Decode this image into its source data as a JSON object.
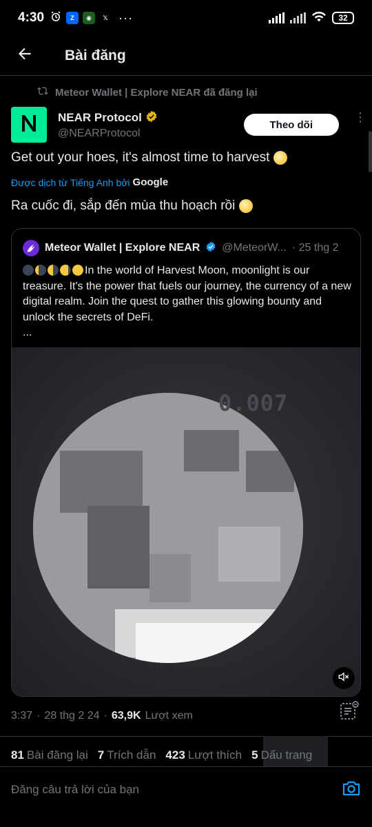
{
  "status_bar": {
    "time": "4:30",
    "battery": "32",
    "app_icons": [
      "zalo-icon",
      "app-icon",
      "x-icon"
    ],
    "dots": "···"
  },
  "header": {
    "title": "Bài đăng"
  },
  "repost": {
    "text": "Meteor Wallet | Explore NEAR đã đăng lại"
  },
  "author": {
    "name": "NEAR Protocol",
    "handle": "@NEARProtocol",
    "follow_label": "Theo dõi"
  },
  "post": {
    "text": "Get out your hoes, it's almost time to harvest",
    "translated_by": "Được dịch từ Tiếng Anh bởi",
    "translated_by_brand": "Google",
    "translated_text": "Ra cuốc đi, sắp đến mùa thu hoạch rồi"
  },
  "quote": {
    "name": "Meteor Wallet | Explore NEAR",
    "handle": "@MeteorW...",
    "date": "· 25 thg 2",
    "body": "In the world of Harvest Moon, moonlight is our treasure. It's the power that fuels our journey, the currency of a new digital realm. Join the quest to gather this glowing bounty and unlock the secrets of DeFi.",
    "ellipsis": "...",
    "media_counter": "0.007"
  },
  "meta": {
    "time": "3:37",
    "date": "28 thg 2 24",
    "views": "63,9K",
    "views_label": "Lượt xem"
  },
  "stats": {
    "reposts": "81",
    "reposts_label": "Bài đăng lại",
    "quotes": "7",
    "quotes_label": "Trích dẫn",
    "likes": "423",
    "likes_label": "Lượt thích",
    "bookmarks": "5",
    "bookmarks_label": "Dấu trang"
  },
  "reply": {
    "placeholder": "Đăng câu trả lời của bạn"
  },
  "colors": {
    "background": "#000000",
    "accent": "#1d9bf0",
    "near_green": "#00ec97",
    "muted": "#71767b",
    "text": "#e7e9ea"
  }
}
